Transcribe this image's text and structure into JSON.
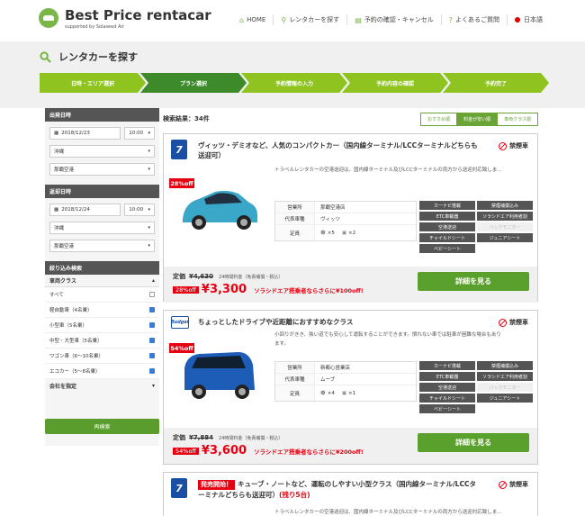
{
  "header": {
    "logo_title": "Best Price rentacar",
    "logo_sub": "supported by Solaseed Air",
    "nav": [
      {
        "icon": "home-icon",
        "glyph": "⌂",
        "label": "HOME"
      },
      {
        "icon": "search-icon",
        "glyph": "⚲",
        "label": "レンタカーを探す"
      },
      {
        "icon": "clipboard-icon",
        "glyph": "▤",
        "label": "予約の確認・キャンセル"
      },
      {
        "icon": "question-icon",
        "glyph": "?",
        "label": "よくあるご質問"
      },
      {
        "icon": "flag-icon",
        "glyph": "",
        "label": "日本語"
      }
    ]
  },
  "page_title": "レンタカーを探す",
  "steps": [
    "日時・エリア選択",
    "プラン選択",
    "予約情報の入力",
    "予約内容の確認",
    "予約完了"
  ],
  "sidebar": {
    "departure_head": "出発日時",
    "departure_date": "2018/12/23",
    "departure_time": "10:00",
    "departure_pref": "沖縄",
    "departure_place": "那覇空港",
    "return_head": "返却日時",
    "return_date": "2018/12/24",
    "return_time": "10:00",
    "return_pref": "沖縄",
    "return_place": "那覇空港",
    "filter_head": "絞り込み検索",
    "class_head": "車両クラス",
    "classes": [
      {
        "label": "すべて",
        "checked": false
      },
      {
        "label": "軽自動車（4名乗）",
        "checked": true
      },
      {
        "label": "小型車（5名乗）",
        "checked": true
      },
      {
        "label": "中型・大型車（5名乗）",
        "checked": true
      },
      {
        "label": "ワゴン車（6〜10名乗）",
        "checked": true
      },
      {
        "label": "エコカー（5〜8名乗）",
        "checked": true
      }
    ],
    "company_head": "会社を指定",
    "research_button": "再検索"
  },
  "results": {
    "count_label": "検索結果：34件",
    "sort_tabs": [
      "おすすめ順",
      "料金が安い順",
      "車両クラス順"
    ],
    "sort_active": 1
  },
  "cards": [
    {
      "title": "ヴィッツ・デミオなど、人気のコンパクトカー（国内線ターミナル/LCCターミナルどちらも送迎可）",
      "smoking": "禁煙車",
      "desc": "トラベルレンタカーの空港送迎は、国内線ターミナル及びLCCターミナルの両方から送迎対応致しま...",
      "discount_badge": "28%off",
      "spec_labels": [
        "営業所",
        "代表車種",
        "定員"
      ],
      "office": "那覇空港店",
      "model": "ヴィッツ",
      "persons": "×5",
      "bags": "×2",
      "options": [
        {
          "label": "カーナビ搭載",
          "on": true
        },
        {
          "label": "禁煙補償込み",
          "on": true
        },
        {
          "label": "ETC車載器",
          "on": true
        },
        {
          "label": "ソラシドエア利用者割",
          "on": true
        },
        {
          "label": "空港送迎",
          "on": true
        },
        {
          "label": "バックモニター",
          "on": false
        },
        {
          "label": "チャイルドシート",
          "on": true
        },
        {
          "label": "ジュニアシート",
          "on": true
        },
        {
          "label": "ベビーシート",
          "on": true
        }
      ],
      "regular_label": "定価",
      "regular_price": "¥4,630",
      "price_note": "24時間料金（免責補償・税込）",
      "off_badge": "28%off",
      "price": "¥3,300",
      "campaign": "ソラシドエア搭乗者ならさらに¥100off!",
      "detail_button": "詳細を見る"
    },
    {
      "title": "ちょっとしたドライブや近距離におすすめなクラス",
      "smoking": "禁煙車",
      "desc_line1": "小回りがきき、狭い道でも安心して運転することができます。慣れない車では駐車が困難な場合もあり",
      "desc_line2": "ます。",
      "discount_badge": "54%off",
      "spec_labels": [
        "営業所",
        "代表車種",
        "定員"
      ],
      "office": "新都心営業店",
      "model": "ムーブ",
      "persons": "×4",
      "bags": "×1",
      "options": [
        {
          "label": "カーナビ搭載",
          "on": true
        },
        {
          "label": "禁煙補償込み",
          "on": true
        },
        {
          "label": "ETC車載器",
          "on": true
        },
        {
          "label": "ソラシドエア利用者割",
          "on": true
        },
        {
          "label": "空港送迎",
          "on": true
        },
        {
          "label": "バックモニター",
          "on": false
        },
        {
          "label": "チャイルドシート",
          "on": true
        },
        {
          "label": "ジュニアシート",
          "on": true
        },
        {
          "label": "ベビーシート",
          "on": true
        }
      ],
      "regular_label": "定価",
      "regular_price": "¥7,884",
      "price_note": "24時間料金（免責補償・税込）",
      "off_badge": "54%off",
      "price": "¥3,600",
      "campaign": "ソラシドエア搭乗者ならさらに¥200off!",
      "detail_button": "詳細を見る"
    },
    {
      "new_badge": "発売開始！",
      "title": "キューブ・ノートなど、運転のしやすい小型クラス（国内線ターミナル/LCCターミナルどちらも送迎可）",
      "remain": "(残り5台)",
      "smoking": "禁煙車",
      "desc": "トラベルレンタカーの空港送迎は、国内線ターミナル及びLCCターミナルの両方から送迎対応致しま..."
    }
  ]
}
